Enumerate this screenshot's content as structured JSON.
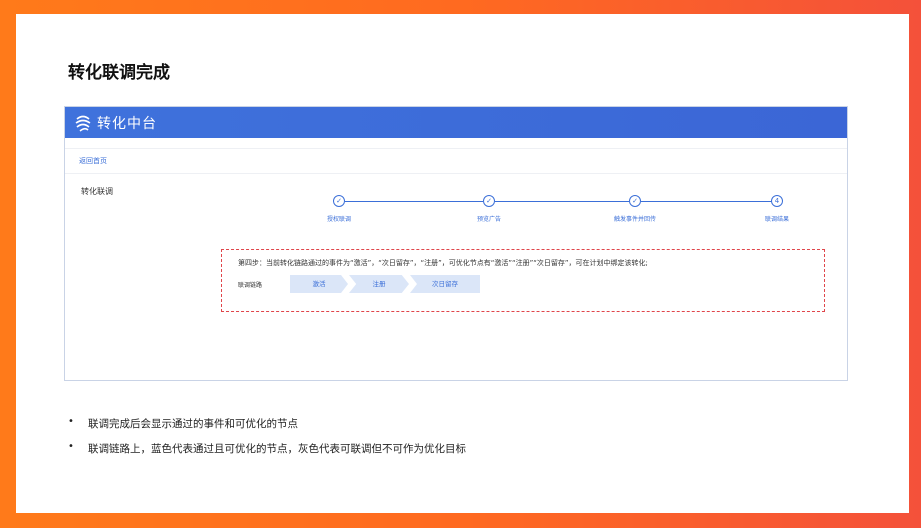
{
  "slide": {
    "title": "转化联调完成",
    "bullets": [
      "联调完成后会显示通过的事件和可优化的节点",
      "联调链路上，蓝色代表通过且可优化的节点，灰色代表可联调但不可作为优化目标"
    ]
  },
  "app": {
    "name": "转化中台",
    "back_link": "返回首页",
    "section_label": "转化联调",
    "steps": [
      {
        "label": "授权联调",
        "marker": "✓"
      },
      {
        "label": "预览广告",
        "marker": "✓"
      },
      {
        "label": "触发事件并回传",
        "marker": "✓"
      },
      {
        "label": "联调结果",
        "marker": "4"
      }
    ],
    "result": {
      "description": "第四步：当前转化链路通过的事件为“激活”，“次日留存”，“注册”，可优化节点有“激活”“注册”“次日留存”，可在计划中绑定该转化;",
      "chain_label": "联调链路",
      "chain_nodes": [
        "激活",
        "注册",
        "次日留存"
      ]
    }
  },
  "colors": {
    "accent": "#3b6fd8",
    "frame": "#ff7a1a",
    "dashed_border": "#e0454a"
  }
}
